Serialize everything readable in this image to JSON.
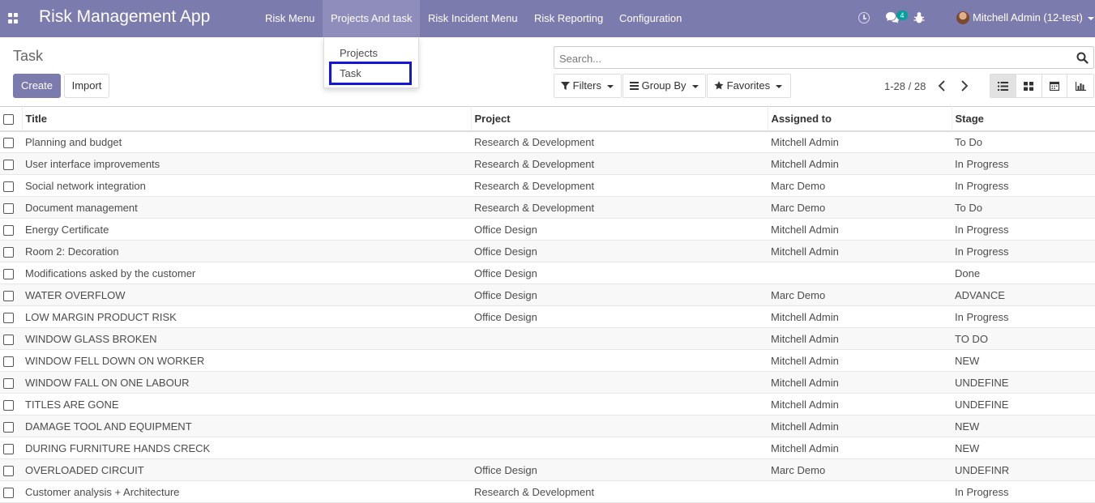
{
  "navbar": {
    "app_name": "Risk Management App",
    "menus": [
      "Risk Menu",
      "Projects And task",
      "Risk Incident Menu",
      "Risk Reporting",
      "Configuration"
    ],
    "chat_count": "4",
    "user": "Mitchell Admin (12-test)"
  },
  "dropdown": {
    "items": [
      "Projects",
      "Task"
    ],
    "highlighted": "Task"
  },
  "control_panel": {
    "title": "Task",
    "create_label": "Create",
    "import_label": "Import",
    "search_placeholder": "Search...",
    "filters_label": "Filters",
    "group_by_label": "Group By",
    "favorites_label": "Favorites",
    "pager": "1-28 / 28",
    "views": [
      "list-icon",
      "kanban-icon",
      "calendar-icon",
      "graph-icon"
    ],
    "active_view": "list-icon"
  },
  "table": {
    "columns": [
      "Title",
      "Project",
      "Assigned to",
      "Stage"
    ],
    "rows": [
      [
        "Planning and budget",
        "Research & Development",
        "Mitchell Admin",
        "To Do"
      ],
      [
        "User interface improvements",
        "Research & Development",
        "Mitchell Admin",
        "In Progress"
      ],
      [
        "Social network integration",
        "Research & Development",
        "Marc Demo",
        "In Progress"
      ],
      [
        "Document management",
        "Research & Development",
        "Marc Demo",
        "To Do"
      ],
      [
        "Energy Certificate",
        "Office Design",
        "Mitchell Admin",
        "In Progress"
      ],
      [
        "Room 2: Decoration",
        "Office Design",
        "Mitchell Admin",
        "In Progress"
      ],
      [
        "Modifications asked by the customer",
        "Office Design",
        "",
        "Done"
      ],
      [
        "WATER OVERFLOW",
        "Office Design",
        "Marc Demo",
        "ADVANCE"
      ],
      [
        "LOW MARGIN PRODUCT RISK",
        "Office Design",
        "Mitchell Admin",
        "In Progress"
      ],
      [
        "WINDOW GLASS BROKEN",
        "",
        "Mitchell Admin",
        "TO DO"
      ],
      [
        "WINDOW FELL DOWN ON WORKER",
        "",
        "Mitchell Admin",
        "NEW"
      ],
      [
        "WINDOW FALL ON ONE LABOUR",
        "",
        "Mitchell Admin",
        "UNDEFINE"
      ],
      [
        "TITLES ARE GONE",
        "",
        "Mitchell Admin",
        "UNDEFINE"
      ],
      [
        "DAMAGE TOOL AND EQUIPMENT",
        "",
        "Mitchell Admin",
        "NEW"
      ],
      [
        "DURING FURNITURE HANDS CRECK",
        "",
        "Mitchell Admin",
        "NEW"
      ],
      [
        "OVERLOADED CIRCUIT",
        "Office Design",
        "Marc Demo",
        "UNDEFINR"
      ],
      [
        "Customer analysis + Architecture",
        "Research & Development",
        "",
        "In Progress"
      ]
    ]
  },
  "colors": {
    "brand": "#7c7bad",
    "highlight_border": "#1515d9",
    "badge": "#00a09d"
  }
}
